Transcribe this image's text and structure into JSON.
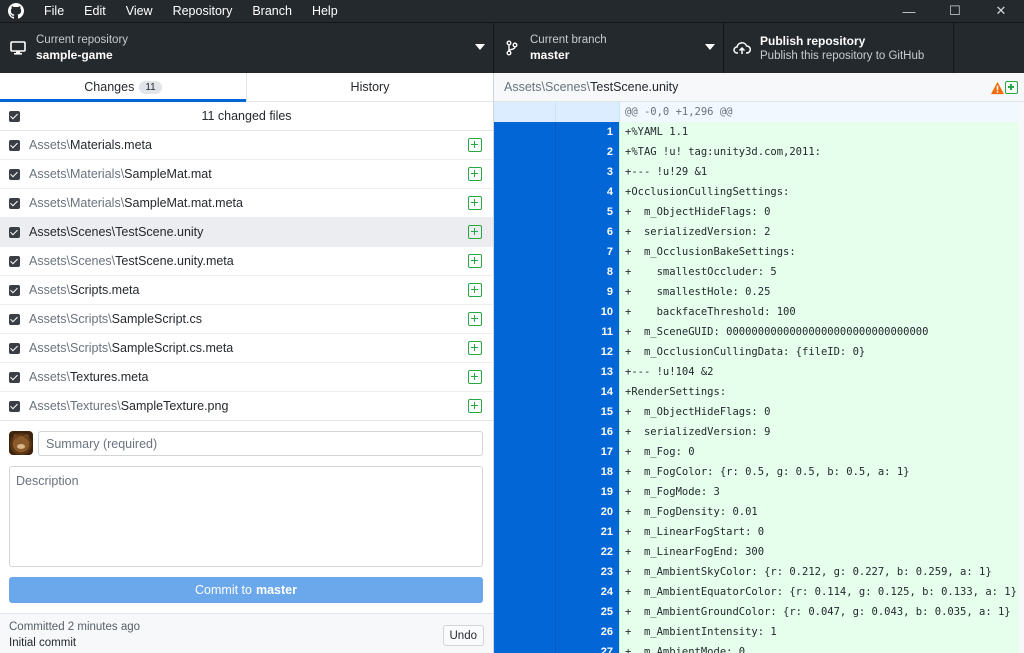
{
  "menu": [
    "File",
    "Edit",
    "View",
    "Repository",
    "Branch",
    "Help"
  ],
  "window_controls": {
    "minimize": "—",
    "maximize": "☐",
    "close": "✕"
  },
  "toolbar": {
    "repo_caption": "Current repository",
    "repo_name": "sample-game",
    "branch_caption": "Current branch",
    "branch_name": "master",
    "publish_title": "Publish repository",
    "publish_sub": "Publish this repository to GitHub"
  },
  "tabs": {
    "changes": "Changes",
    "changes_count": "11",
    "history": "History"
  },
  "changed_files_label": "11 changed files",
  "files": [
    {
      "dir": "Assets\\",
      "name": "Materials.meta"
    },
    {
      "dir": "Assets\\Materials\\",
      "name": "SampleMat.mat"
    },
    {
      "dir": "Assets\\Materials\\",
      "name": "SampleMat.mat.meta"
    },
    {
      "dir": "Assets\\Scenes\\",
      "name": "TestScene.unity"
    },
    {
      "dir": "Assets\\Scenes\\",
      "name": "TestScene.unity.meta"
    },
    {
      "dir": "Assets\\",
      "name": "Scripts.meta"
    },
    {
      "dir": "Assets\\Scripts\\",
      "name": "SampleScript.cs"
    },
    {
      "dir": "Assets\\Scripts\\",
      "name": "SampleScript.cs.meta"
    },
    {
      "dir": "Assets\\",
      "name": "Textures.meta"
    },
    {
      "dir": "Assets\\Textures\\",
      "name": "SampleTexture.png"
    }
  ],
  "selected_file_index": 3,
  "commit": {
    "summary_placeholder": "Summary (required)",
    "description_placeholder": "Description",
    "button_prefix": "Commit to",
    "button_branch": "master"
  },
  "last_commit": {
    "time": "Committed 2 minutes ago",
    "message": "Initial commit",
    "undo_label": "Undo"
  },
  "diff": {
    "path_dir": "Assets\\Scenes\\",
    "path_file": "TestScene.unity",
    "hunk": "@@ -0,0 +1,296 @@",
    "lines": [
      {
        "n": "1",
        "t": "+%YAML 1.1"
      },
      {
        "n": "2",
        "t": "+%TAG !u! tag:unity3d.com,2011:"
      },
      {
        "n": "3",
        "t": "+--- !u!29 &1"
      },
      {
        "n": "4",
        "t": "+OcclusionCullingSettings:"
      },
      {
        "n": "5",
        "t": "+  m_ObjectHideFlags: 0"
      },
      {
        "n": "6",
        "t": "+  serializedVersion: 2"
      },
      {
        "n": "7",
        "t": "+  m_OcclusionBakeSettings:"
      },
      {
        "n": "8",
        "t": "+    smallestOccluder: 5"
      },
      {
        "n": "9",
        "t": "+    smallestHole: 0.25"
      },
      {
        "n": "10",
        "t": "+    backfaceThreshold: 100"
      },
      {
        "n": "11",
        "t": "+  m_SceneGUID: 00000000000000000000000000000000"
      },
      {
        "n": "12",
        "t": "+  m_OcclusionCullingData: {fileID: 0}"
      },
      {
        "n": "13",
        "t": "+--- !u!104 &2"
      },
      {
        "n": "14",
        "t": "+RenderSettings:"
      },
      {
        "n": "15",
        "t": "+  m_ObjectHideFlags: 0"
      },
      {
        "n": "16",
        "t": "+  serializedVersion: 9"
      },
      {
        "n": "17",
        "t": "+  m_Fog: 0"
      },
      {
        "n": "18",
        "t": "+  m_FogColor: {r: 0.5, g: 0.5, b: 0.5, a: 1}"
      },
      {
        "n": "19",
        "t": "+  m_FogMode: 3"
      },
      {
        "n": "20",
        "t": "+  m_FogDensity: 0.01"
      },
      {
        "n": "21",
        "t": "+  m_LinearFogStart: 0"
      },
      {
        "n": "22",
        "t": "+  m_LinearFogEnd: 300"
      },
      {
        "n": "23",
        "t": "+  m_AmbientSkyColor: {r: 0.212, g: 0.227, b: 0.259, a: 1}"
      },
      {
        "n": "24",
        "t": "+  m_AmbientEquatorColor: {r: 0.114, g: 0.125, b: 0.133, a: 1}"
      },
      {
        "n": "25",
        "t": "+  m_AmbientGroundColor: {r: 0.047, g: 0.043, b: 0.035, a: 1}"
      },
      {
        "n": "26",
        "t": "+  m_AmbientIntensity: 1"
      },
      {
        "n": "27",
        "t": "+  m_AmbientMode: 0"
      }
    ]
  },
  "colors": {
    "accent": "#0366d6",
    "added": "#28a745",
    "added_bg": "#e6ffed",
    "warning": "#f66a0a"
  }
}
